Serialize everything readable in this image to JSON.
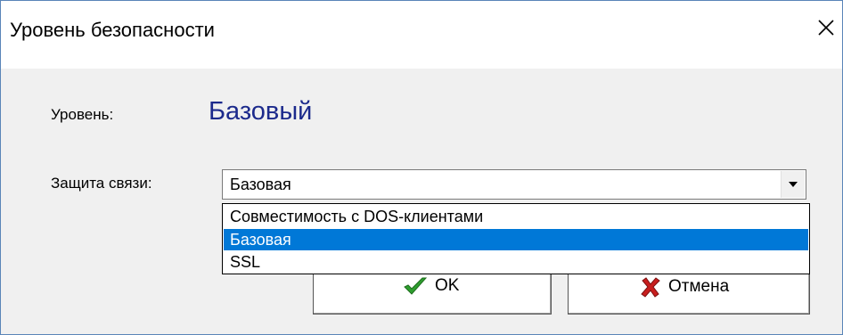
{
  "window": {
    "title": "Уровень безопасности",
    "close_icon": "close-icon"
  },
  "form": {
    "level_label": "Уровень:",
    "level_value": "Базовый",
    "protection_label": "Защита связи:",
    "protection_selected": "Базовая"
  },
  "dropdown": {
    "options": [
      "Совместимость с DOS-клиентами",
      "Базовая",
      "SSL"
    ],
    "selected_index": 1
  },
  "buttons": {
    "ok_label": "OK",
    "ok_icon": "checkmark-icon",
    "cancel_label": "Отмена",
    "cancel_icon": "red-x-icon"
  },
  "colors": {
    "level_value": "#1c2a8c",
    "selection": "#0078d7",
    "ok_icon": "#2f9e2f",
    "cancel_icon": "#c81e1e"
  }
}
